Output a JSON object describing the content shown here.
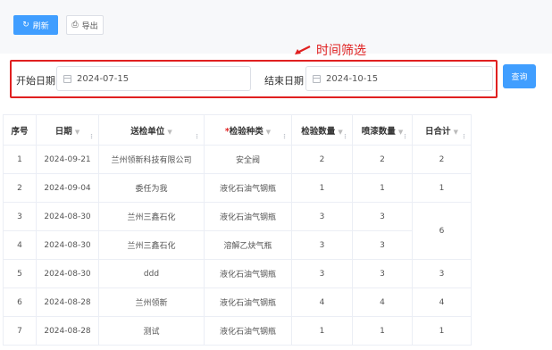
{
  "toolbar": {
    "refresh_label": "刷新",
    "export_label": "导出"
  },
  "annotation": {
    "text": "时间筛选",
    "color": "#e02020"
  },
  "filter": {
    "start_label": "开始日期",
    "start_value": "2024-07-15",
    "end_label": "结束日期",
    "end_value": "2024-10-15",
    "query_label": "查询"
  },
  "table": {
    "headers": [
      "序号",
      "日期",
      "送检单位",
      "检验种类",
      "检验数量",
      "喷漆数量",
      "日合计"
    ],
    "rows": [
      [
        "1",
        "2024-09-21",
        "兰州领新科技有限公司",
        "安全阀",
        "2",
        "2",
        "2"
      ],
      [
        "2",
        "2024-09-04",
        "委任为我",
        "液化石油气钢瓶",
        "1",
        "1",
        "1"
      ],
      [
        "3",
        "2024-08-30",
        "兰州三鑫石化",
        "液化石油气钢瓶",
        "3",
        "3",
        "6"
      ],
      [
        "4",
        "2024-08-30",
        "兰州三鑫石化",
        "溶解乙炔气瓶",
        "3",
        "3",
        ""
      ],
      [
        "5",
        "2024-08-30",
        "ddd",
        "液化石油气钢瓶",
        "3",
        "3",
        "3"
      ],
      [
        "6",
        "2024-08-28",
        "兰州领新",
        "液化石油气钢瓶",
        "4",
        "4",
        "4"
      ],
      [
        "7",
        "2024-08-28",
        "测试",
        "液化石油气钢瓶",
        "1",
        "1",
        "1"
      ]
    ]
  },
  "colors": {
    "primary": "#409eff",
    "annotation_red": "#e02020"
  }
}
